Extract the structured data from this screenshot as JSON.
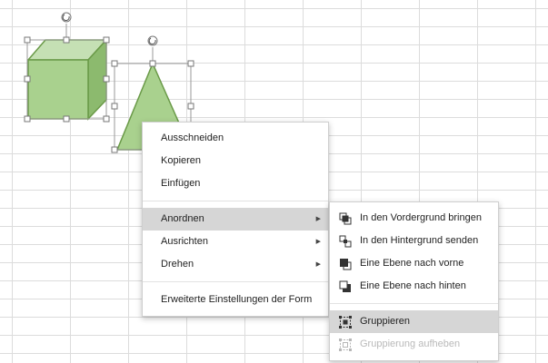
{
  "context_menu": {
    "items": [
      {
        "label": "Ausschneiden"
      },
      {
        "label": "Kopieren"
      },
      {
        "label": "Einfügen"
      },
      {
        "label": "Anordnen",
        "submenu": true,
        "highlighted": true
      },
      {
        "label": "Ausrichten",
        "submenu": true
      },
      {
        "label": "Drehen",
        "submenu": true
      },
      {
        "label": "Erweiterte Einstellungen der Form"
      }
    ]
  },
  "arrange_submenu": {
    "items": [
      {
        "label": "In den Vordergrund bringen",
        "icon": "bring-to-front-icon"
      },
      {
        "label": "In den Hintergrund senden",
        "icon": "send-to-back-icon"
      },
      {
        "label": "Eine Ebene nach vorne",
        "icon": "bring-forward-icon"
      },
      {
        "label": "Eine Ebene nach hinten",
        "icon": "send-backward-icon"
      },
      {
        "label": "Gruppieren",
        "icon": "group-icon",
        "highlighted": true
      },
      {
        "label": "Gruppierung aufheben",
        "icon": "ungroup-icon",
        "disabled": true
      }
    ]
  },
  "colors": {
    "shape_fill": "#a9d18e",
    "shape_fill_dark": "#8cba6e",
    "shape_fill_light": "#c5e0b4",
    "shape_stroke": "#6a9a48",
    "highlight": "#d6d6d6",
    "grid_line": "#dcdcdc"
  }
}
